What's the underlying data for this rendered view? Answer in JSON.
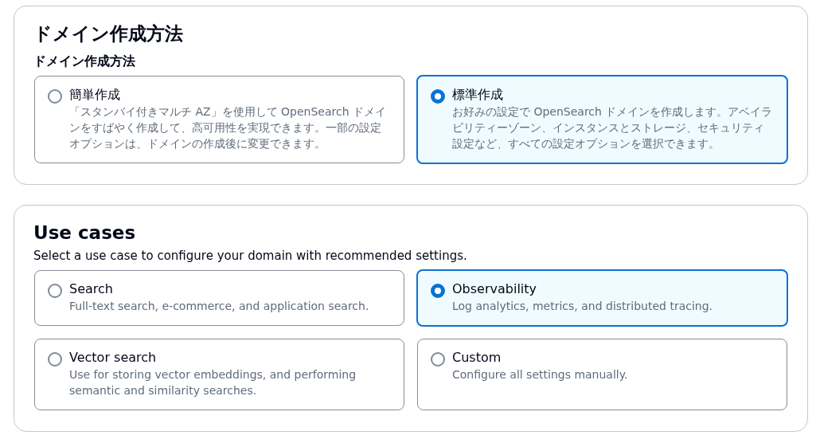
{
  "sections": [
    {
      "title": "ドメイン作成方法",
      "label": "ドメイン作成方法",
      "options": [
        {
          "label": "簡単作成",
          "description": "「スタンバイ付きマルチ AZ」を使用して OpenSearch ドメインをすばやく作成して、高可用性を実現できます。一部の設定オプションは、ドメインの作成後に変更できます。",
          "selected": false
        },
        {
          "label": "標準作成",
          "description": "お好みの設定で OpenSearch ドメインを作成します。アベイラビリティーゾーン、インスタンスとストレージ、セキュリティ設定など、すべての設定オプションを選択できます。",
          "selected": true
        }
      ]
    },
    {
      "title": "Use cases",
      "description": "Select a use case to configure your domain with recommended settings.",
      "options": [
        {
          "label": "Search",
          "description": "Full-text search, e-commerce, and application search.",
          "selected": false
        },
        {
          "label": "Observability",
          "description": "Log analytics, metrics, and distributed tracing.",
          "selected": true
        },
        {
          "label": "Vector search",
          "description": "Use for storing vector embeddings, and performing semantic and similarity searches.",
          "selected": false
        },
        {
          "label": "Custom",
          "description": "Configure all settings manually.",
          "selected": false
        }
      ]
    }
  ]
}
